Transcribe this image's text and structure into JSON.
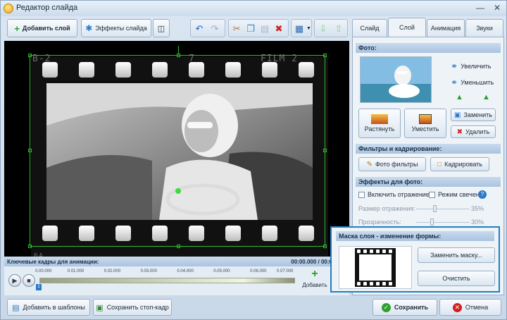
{
  "window": {
    "title": "Редактор слайда"
  },
  "toolbar": {
    "add_layer_label": "Добавить слой",
    "slide_effects_label": "Эффекты слайда"
  },
  "preview": {
    "film_top_left": "B-2",
    "film_top_mid": "7",
    "film_top_right": "FILM 2",
    "film_bottom_left": "6A"
  },
  "tabs": [
    {
      "label": "Слайд"
    },
    {
      "label": "Слой"
    },
    {
      "label": "Анимация"
    },
    {
      "label": "Звуки"
    }
  ],
  "photo_section": {
    "title": "Фото:",
    "zoom_in_label": "Увеличить",
    "zoom_out_label": "Уменьшить",
    "stretch_label": "Растянуть",
    "fit_label": "Уместить",
    "replace_label": "Заменить",
    "delete_label": "Удалить"
  },
  "filters_section": {
    "title": "Фильтры и кадрирование:",
    "photo_filters_label": "Фото фильтры",
    "crop_label": "Кадрировать"
  },
  "effects_section": {
    "title": "Эффекты для фото:",
    "reflection_label": "Включить отражение",
    "glow_label": "Режим свечения",
    "reflection_size_label": "Размер отражения:",
    "reflection_size_value": "35%",
    "reflection_size_level": 0.35,
    "transparency_label": "Прозрачность:",
    "transparency_value": "30%",
    "transparency_level": 0.3
  },
  "mask_section": {
    "title": "Маска слоя - изменение формы:",
    "replace_mask_label": "Заменить маску...",
    "clear_label": "Очистить"
  },
  "keyframes": {
    "title": "Ключевые кадры для анимации:",
    "time": "00:00.000 / 00:07.000",
    "ticks": [
      "0.00.000",
      "0.01.000",
      "0.02.000",
      "0.03.000",
      "0.04.000",
      "0.05.000",
      "0.06.000",
      "0.07.000"
    ],
    "marker_label": "1",
    "add_label": "Добавить"
  },
  "bottom": {
    "add_template_label": "Добавить в шаблоны",
    "save_frame_label": "Сохранить стоп-кадр",
    "save_label": "Сохранить",
    "cancel_label": "Отмена"
  },
  "colors": {
    "accent": "#1f7fc4",
    "selection": "#2fbf2f",
    "section_header": "#aac4e0"
  }
}
